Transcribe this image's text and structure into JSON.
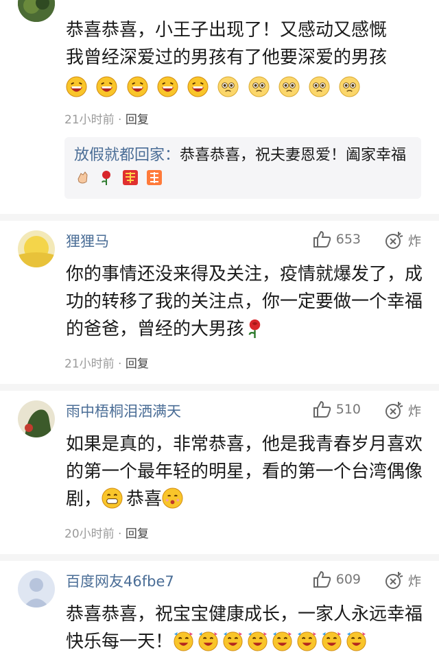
{
  "comments": [
    {
      "user": "",
      "text_line1": "恭喜恭喜，小王子出现了！又感动又感慨",
      "text_line2": "我曾经深爱过的男孩有了他要深爱的男孩",
      "time": "21小时前",
      "dot": "·",
      "reply": "回复",
      "subreply": {
        "name": "放假就都回家",
        "sep": "：",
        "text": "恭喜恭喜，祝夫妻恩爱！阖家幸福"
      }
    },
    {
      "user": "狸狸马",
      "likes": "653",
      "zha": "炸",
      "text": "你的事情还没来得及关注，疫情就爆发了，成功的转移了我的关注点，你一定要做一个幸福的爸爸，曾经的大男孩",
      "time": "21小时前",
      "dot": "·",
      "reply": "回复"
    },
    {
      "user": "雨中梧桐泪洒满天",
      "likes": "510",
      "zha": "炸",
      "text": "如果是真的，非常恭喜，他是我青春岁月喜欢的第一个最年轻的明星，看的第一个台湾偶像剧，",
      "text_tail": "恭喜",
      "time": "20小时前",
      "dot": "·",
      "reply": "回复"
    },
    {
      "user": "百度网友46fbe7",
      "likes": "609",
      "zha": "炸",
      "text": "恭喜恭喜，祝宝宝健康成长，一家人永远幸福快乐每一天！",
      "time": "",
      "reply": ""
    }
  ],
  "colors": {
    "username": "#4a6d96",
    "divider": "#f5f5f5",
    "meta": "#9a9a9a"
  }
}
